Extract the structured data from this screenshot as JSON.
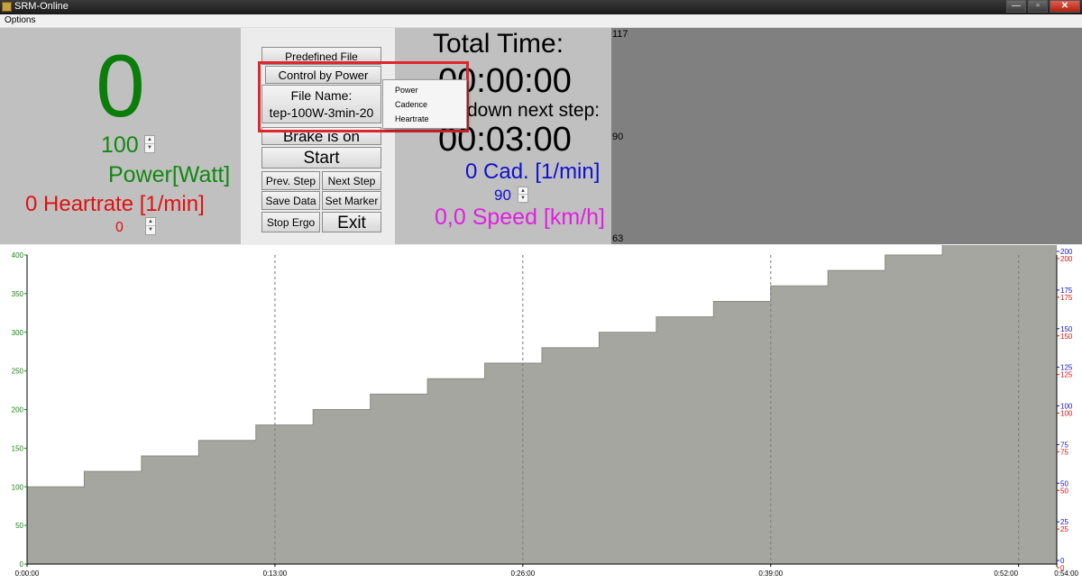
{
  "window": {
    "title": "SRM-Online",
    "minimize": "—",
    "maximize": "▫",
    "close": "✕"
  },
  "menu": {
    "options": "Options"
  },
  "power": {
    "current": "0",
    "setpoint": "100",
    "label": "Power[Watt]"
  },
  "heartrate": {
    "label": "0 Heartrate [1/min]",
    "setpoint": "0"
  },
  "controls": {
    "predefined_file": "Predefined File",
    "control_by": "Control by Power",
    "file_name_label": "File Name:",
    "file_name_value": "tep-100W-3min-20",
    "brake": "Brake is on",
    "start": "Start",
    "prev_step": "Prev. Step",
    "next_step": "Next Step",
    "save_data": "Save Data",
    "set_marker": "Set Marker",
    "stop_ergo": "Stop Ergo",
    "exit": "Exit"
  },
  "time": {
    "total_label": "Total Time:",
    "total_value": "00:00:00",
    "countdown_label": "down next step:",
    "step_value": "00:03:00"
  },
  "cadence": {
    "label": "0 Cad. [1/min]",
    "setpoint": "90"
  },
  "speed": {
    "label": "0,0 Speed [km/h]"
  },
  "mini_graph": {
    "ticks": [
      "117",
      "90",
      "63"
    ]
  },
  "dropdown": {
    "items": [
      "Power",
      "Cadence",
      "Heartrate"
    ]
  },
  "colors": {
    "power": "#118811",
    "heartrate": "#e01010",
    "cadence": "#1010d0",
    "speed": "#e020e0",
    "highlight": "#e0252f",
    "profile_fill": "#a6a6a0"
  },
  "chart_data": {
    "type": "area",
    "step": true,
    "x_unit": "minutes",
    "x_ticks": [
      "0:00:00",
      "0:13:00",
      "0:26:00",
      "0:39:00",
      "0:52:00",
      "0:54:00"
    ],
    "x_tick_values": [
      0,
      13,
      26,
      39,
      52,
      54
    ],
    "xlim": [
      0,
      54
    ],
    "y_left": {
      "ticks": [
        "0",
        "50",
        "100",
        "150",
        "200",
        "250",
        "300",
        "350",
        "400"
      ],
      "ylim": [
        0,
        400
      ],
      "color": "#118811"
    },
    "y_right_blue": {
      "ticks": [
        "0",
        "25",
        "50",
        "75",
        "100",
        "125",
        "150",
        "175",
        "200"
      ],
      "color": "#1010d0"
    },
    "y_right_red": {
      "ticks": [
        "0",
        "25",
        "50",
        "75",
        "100",
        "125",
        "150",
        "175",
        "200"
      ],
      "color": "#e01010"
    },
    "grid": true,
    "series": [
      {
        "x": [
          0,
          3,
          6,
          9,
          12,
          15,
          18,
          21,
          24,
          27,
          30,
          33,
          36,
          39,
          42,
          45,
          48,
          54
        ],
        "values": [
          100,
          120,
          140,
          160,
          180,
          200,
          220,
          240,
          260,
          280,
          300,
          320,
          340,
          360,
          380,
          400,
          420,
          420
        ]
      }
    ]
  }
}
